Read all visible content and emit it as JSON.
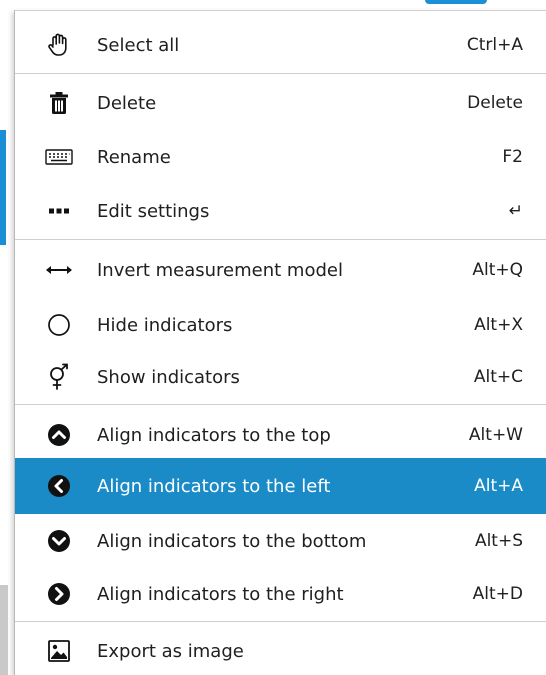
{
  "menu": {
    "items": [
      {
        "id": "select-all",
        "label": "Select all",
        "shortcut": "Ctrl+A",
        "icon": "hand-pointer-icon"
      },
      {
        "id": "delete",
        "label": "Delete",
        "shortcut": "Delete",
        "icon": "trash-icon"
      },
      {
        "id": "rename",
        "label": "Rename",
        "shortcut": "F2",
        "icon": "keyboard-icon"
      },
      {
        "id": "edit-settings",
        "label": "Edit settings",
        "shortcut": "↵",
        "icon": "ellipsis-icon"
      },
      {
        "id": "invert-measurement-model",
        "label": "Invert measurement model",
        "shortcut": "Alt+Q",
        "icon": "double-arrow-icon"
      },
      {
        "id": "hide-indicators",
        "label": "Hide indicators",
        "shortcut": "Alt+X",
        "icon": "circle-icon"
      },
      {
        "id": "show-indicators",
        "label": "Show indicators",
        "shortcut": "Alt+C",
        "icon": "venus-mars-icon"
      },
      {
        "id": "align-top",
        "label": "Align indicators to the top",
        "shortcut": "Alt+W",
        "icon": "chevron-up-circle-icon"
      },
      {
        "id": "align-left",
        "label": "Align indicators to the left",
        "shortcut": "Alt+A",
        "icon": "chevron-left-circle-icon",
        "active": true
      },
      {
        "id": "align-bottom",
        "label": "Align indicators to the bottom",
        "shortcut": "Alt+S",
        "icon": "chevron-down-circle-icon"
      },
      {
        "id": "align-right",
        "label": "Align indicators to the right",
        "shortcut": "Alt+D",
        "icon": "chevron-right-circle-icon"
      },
      {
        "id": "export-image",
        "label": "Export as image",
        "shortcut": "",
        "icon": "image-icon"
      }
    ]
  },
  "colors": {
    "highlight": "#1b8bc8",
    "app_accent": "#1a8fd6",
    "separator": "#cfcfcf"
  }
}
